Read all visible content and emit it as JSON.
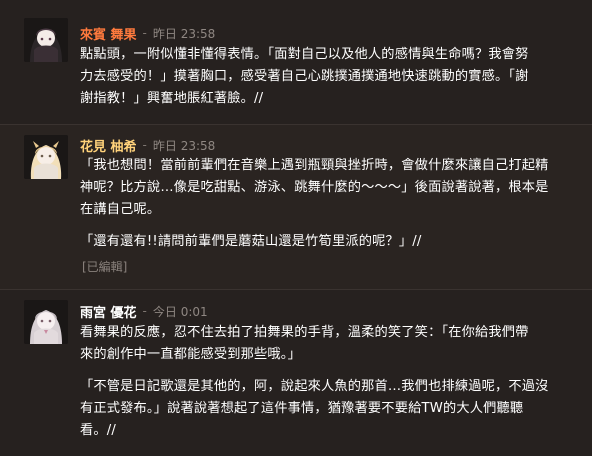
{
  "posts": [
    {
      "author": "來賓 舞果",
      "author_color": "#ff7a3d",
      "sep": "-",
      "time": "昨日 23:58",
      "lines": [
        "點點頭，一附似懂非懂得表情。「面對自己以及他人的感情與生命嗎？我會努",
        "力去感受的！」摸著胸口，感受著自己心跳撲通撲通地快速跳動的實感。「謝",
        "謝指教！」興奮地脹紅著臉。//"
      ]
    },
    {
      "author": "花見 柚希",
      "author_color": "#ffd27a",
      "sep": "-",
      "time": "昨日 23:58",
      "lines": [
        "「我也想問！當前前輩們在音樂上遇到瓶頸與挫折時，會做什麼來讓自己打起精",
        "神呢？比方說…像是吃甜點、游泳、跳舞什麼的～～～」後面說著說著，根本是",
        "在講自己呢。"
      ],
      "lines2": [
        "「還有還有!!請問前輩們是蘑菇山還是竹筍里派的呢？」//"
      ],
      "edited": "[已編輯]"
    },
    {
      "author": "雨宮 優花",
      "author_color": "#ffffff",
      "sep": "-",
      "time": "今日 0:01",
      "lines": [
        "看舞果的反應，忍不住去拍了拍舞果的手背，溫柔的笑了笑：「在你給我們帶",
        "來的創作中一直都能感受到那些哦。」"
      ],
      "lines2": [
        "「不管是日記歌還是其他的，阿，說起來人魚的那首…我們也排練過呢，不過沒",
        "有正式發布。」說著說著想起了這件事情，猶豫著要不要給TW的大人們聽聽",
        "看。//"
      ]
    }
  ]
}
